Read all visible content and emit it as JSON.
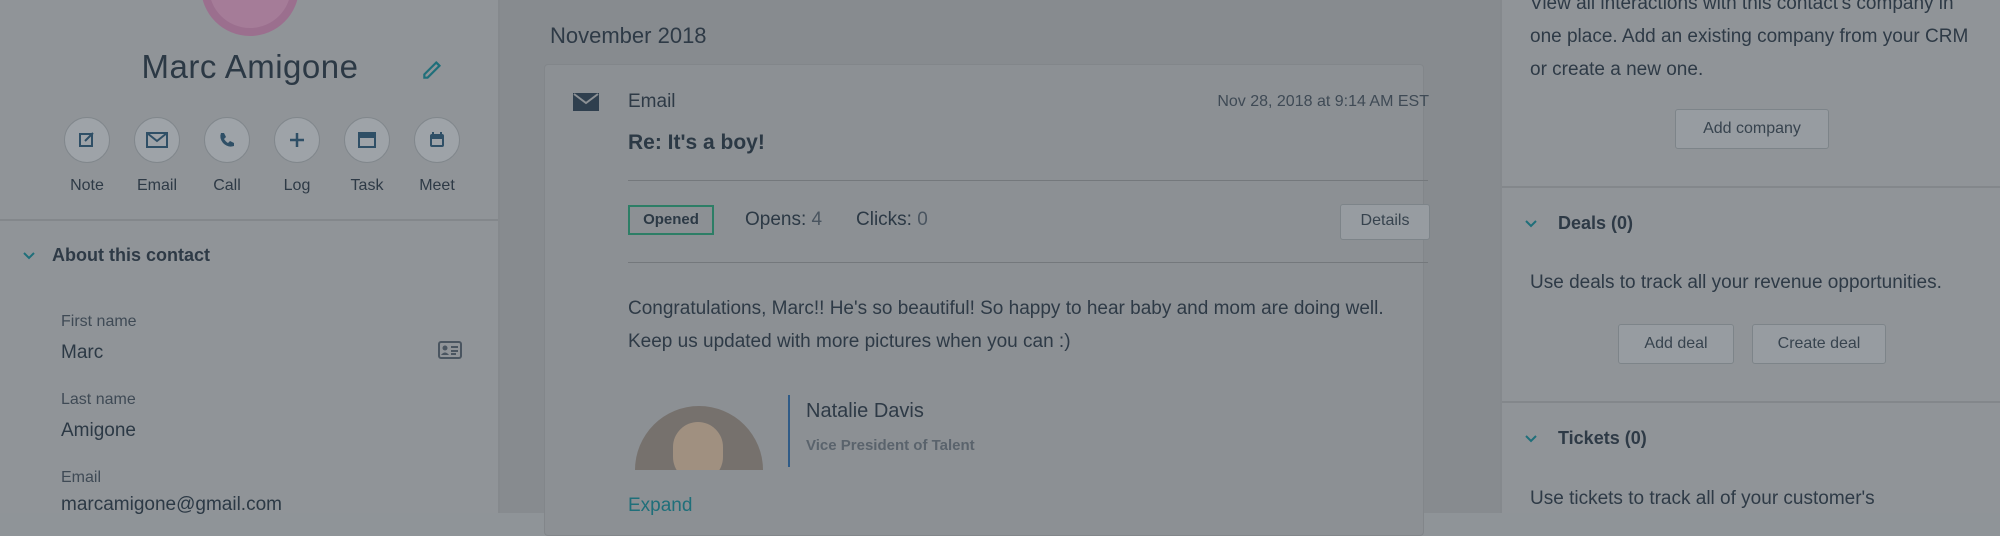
{
  "contact": {
    "name": "Marc Amigone",
    "actions": [
      {
        "label": "Note",
        "icon": "note-icon"
      },
      {
        "label": "Email",
        "icon": "email-icon"
      },
      {
        "label": "Call",
        "icon": "call-icon"
      },
      {
        "label": "Log",
        "icon": "plus-icon"
      },
      {
        "label": "Task",
        "icon": "task-icon"
      },
      {
        "label": "Meet",
        "icon": "calendar-icon"
      }
    ]
  },
  "about": {
    "title": "About this contact",
    "first_name_label": "First name",
    "first_name": "Marc",
    "last_name_label": "Last name",
    "last_name": "Amigone",
    "email_label": "Email",
    "email": "marcamigone@gmail.com"
  },
  "timeline": {
    "month": "November 2018",
    "email": {
      "type": "Email",
      "date": "Nov 28, 2018 at 9:14 AM EST",
      "subject": "Re: It's a boy!",
      "status": "Opened",
      "opens_label": "Opens:",
      "opens": "4",
      "clicks_label": "Clicks:",
      "clicks": "0",
      "details_label": "Details",
      "body": "Congratulations, Marc!! He's so beautiful! So happy to hear baby and mom are doing well. Keep us updated with more pictures when you can :)",
      "signature_name": "Natalie Davis",
      "signature_title": "Vice President of Talent",
      "expand_label": "Expand"
    }
  },
  "sidebar": {
    "companies_text": "View all interactions with this contact's company in one place. Add an existing company from your CRM or create a new one.",
    "add_company_label": "Add company",
    "deals_title": "Deals (0)",
    "deals_text": "Use deals to track all your revenue opportunities.",
    "add_deal_label": "Add deal",
    "create_deal_label": "Create deal",
    "tickets_title": "Tickets (0)",
    "tickets_text": "Use tickets to track all of your customer's"
  },
  "colors": {
    "accent": "#1f6f7a",
    "opened_border": "#2d7e66"
  }
}
